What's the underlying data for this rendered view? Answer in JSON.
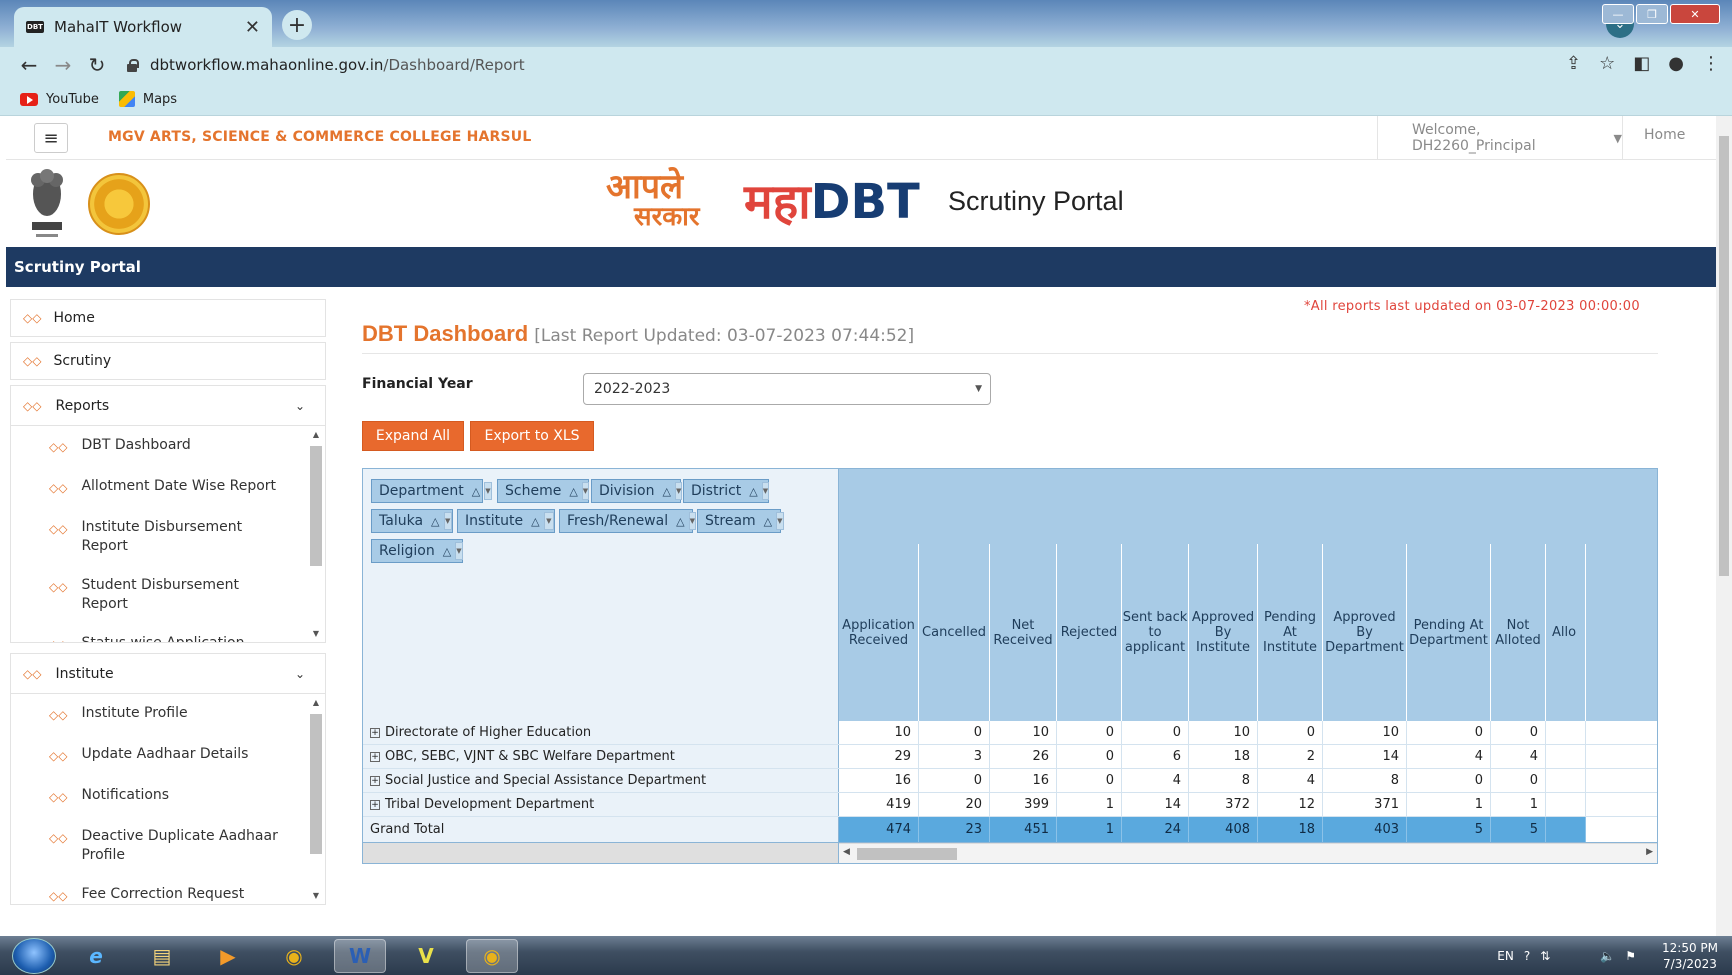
{
  "browser": {
    "tab_title": "MahaIT Workflow",
    "tab_favicon": "DBT",
    "url_domain": "dbtworkflow.mahaonline.gov.in",
    "url_path": "/Dashboard/Report",
    "bookmarks": [
      {
        "label": "YouTube",
        "icon": "youtube-icon"
      },
      {
        "label": "Maps",
        "icon": "maps-icon"
      }
    ]
  },
  "topnav": {
    "college_name": "MGV ARTS, SCIENCE & COMMERCE COLLEGE HARSUL",
    "welcome": "Welcome, DH2260_Principal",
    "home": "Home"
  },
  "header": {
    "logo_aaple_line1": "आपले",
    "logo_aaple_line2": "सरकार",
    "logo_maha": "महा",
    "logo_dbt": "DBT",
    "portal_title": "Scrutiny Portal"
  },
  "bluebar": {
    "title": "Scrutiny Portal"
  },
  "sidebar": {
    "home": "Home",
    "scrutiny": "Scrutiny",
    "reports": {
      "label": "Reports",
      "items": [
        "DBT Dashboard",
        "Allotment Date Wise Report",
        "Institute Disbursement Report",
        "Student Disbursement Report",
        "Status wise Application Detail Report"
      ]
    },
    "institute": {
      "label": "Institute",
      "items": [
        "Institute Profile",
        "Update Aadhaar Details",
        "Notifications",
        "Deactive Duplicate Aadhaar Profile",
        "Fee Correction Request"
      ]
    }
  },
  "main": {
    "updated_note": "*All reports last updated on 03-07-2023 00:00:00",
    "title": "DBT Dashboard",
    "last_updated": "[Last Report Updated: 03-07-2023 07:44:52]",
    "fy_label": "Financial Year",
    "fy_value": "2022-2023",
    "expand_all": "Expand All",
    "export_xls": "Export to XLS"
  },
  "pivot": {
    "fields": [
      "Department",
      "Scheme",
      "Division",
      "District",
      "Taluka",
      "Institute",
      "Fresh/Renewal",
      "Stream",
      "Religion"
    ],
    "columns": [
      "Application Received",
      "Cancelled",
      "Net Received",
      "Rejected",
      "Sent back to applicant",
      "Approved By Institute",
      "Pending At Institute",
      "Approved By Department",
      "Pending At Department",
      "Not Alloted",
      "Allo"
    ],
    "rows": [
      {
        "label": "Directorate of Higher Education",
        "values": [
          10,
          0,
          10,
          0,
          0,
          10,
          0,
          10,
          0,
          0
        ]
      },
      {
        "label": "OBC, SEBC, VJNT & SBC Welfare Department",
        "values": [
          29,
          3,
          26,
          0,
          6,
          18,
          2,
          14,
          4,
          4
        ]
      },
      {
        "label": "Social Justice and Special Assistance Department",
        "values": [
          16,
          0,
          16,
          0,
          4,
          8,
          4,
          8,
          0,
          0
        ]
      },
      {
        "label": "Tribal Development Department",
        "values": [
          419,
          20,
          399,
          1,
          14,
          372,
          12,
          371,
          1,
          1
        ]
      }
    ],
    "total": {
      "label": "Grand Total",
      "values": [
        474,
        23,
        451,
        1,
        24,
        408,
        18,
        403,
        5,
        5
      ]
    }
  },
  "taskbar": {
    "lang": "EN",
    "time": "12:50 PM",
    "date": "7/3/2023"
  }
}
